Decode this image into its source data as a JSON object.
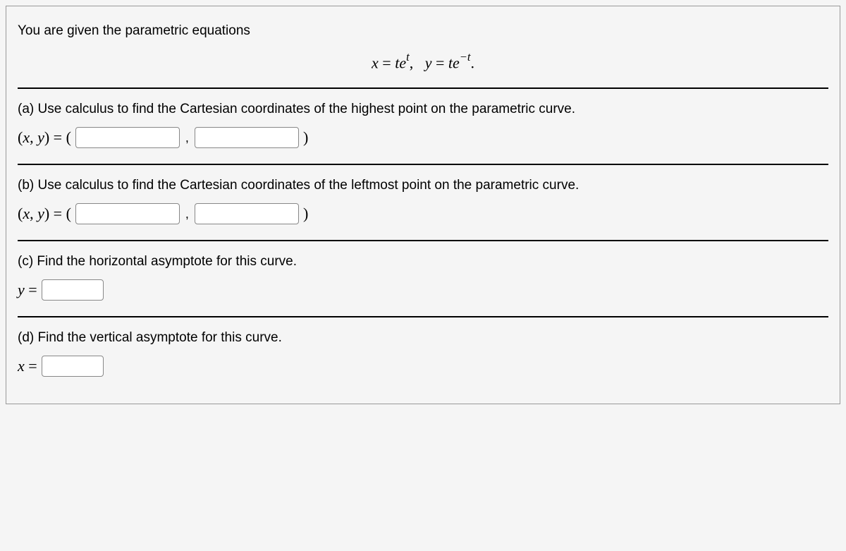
{
  "intro": "You are given the parametric equations",
  "equation": {
    "x_lhs": "x",
    "eq": "=",
    "x_rhs_base": "te",
    "x_rhs_sup": "t",
    "sep": ",",
    "y_lhs": "y",
    "y_rhs_base": "te",
    "y_rhs_sup": "−t",
    "period": "."
  },
  "parts": {
    "a": {
      "text": "(a) Use calculus to find the Cartesian coordinates of the highest point on the parametric curve.",
      "prefix": "(x, y) = (",
      "suffix": ")",
      "comma": ","
    },
    "b": {
      "text": "(b) Use calculus to find the Cartesian coordinates of the leftmost point on the parametric curve.",
      "prefix": "(x, y) = (",
      "suffix": ")",
      "comma": ","
    },
    "c": {
      "text": "(c) Find the horizontal asymptote for this curve.",
      "prefix": "y ="
    },
    "d": {
      "text": "(d) Find the vertical asymptote for this curve.",
      "prefix": "x ="
    }
  }
}
